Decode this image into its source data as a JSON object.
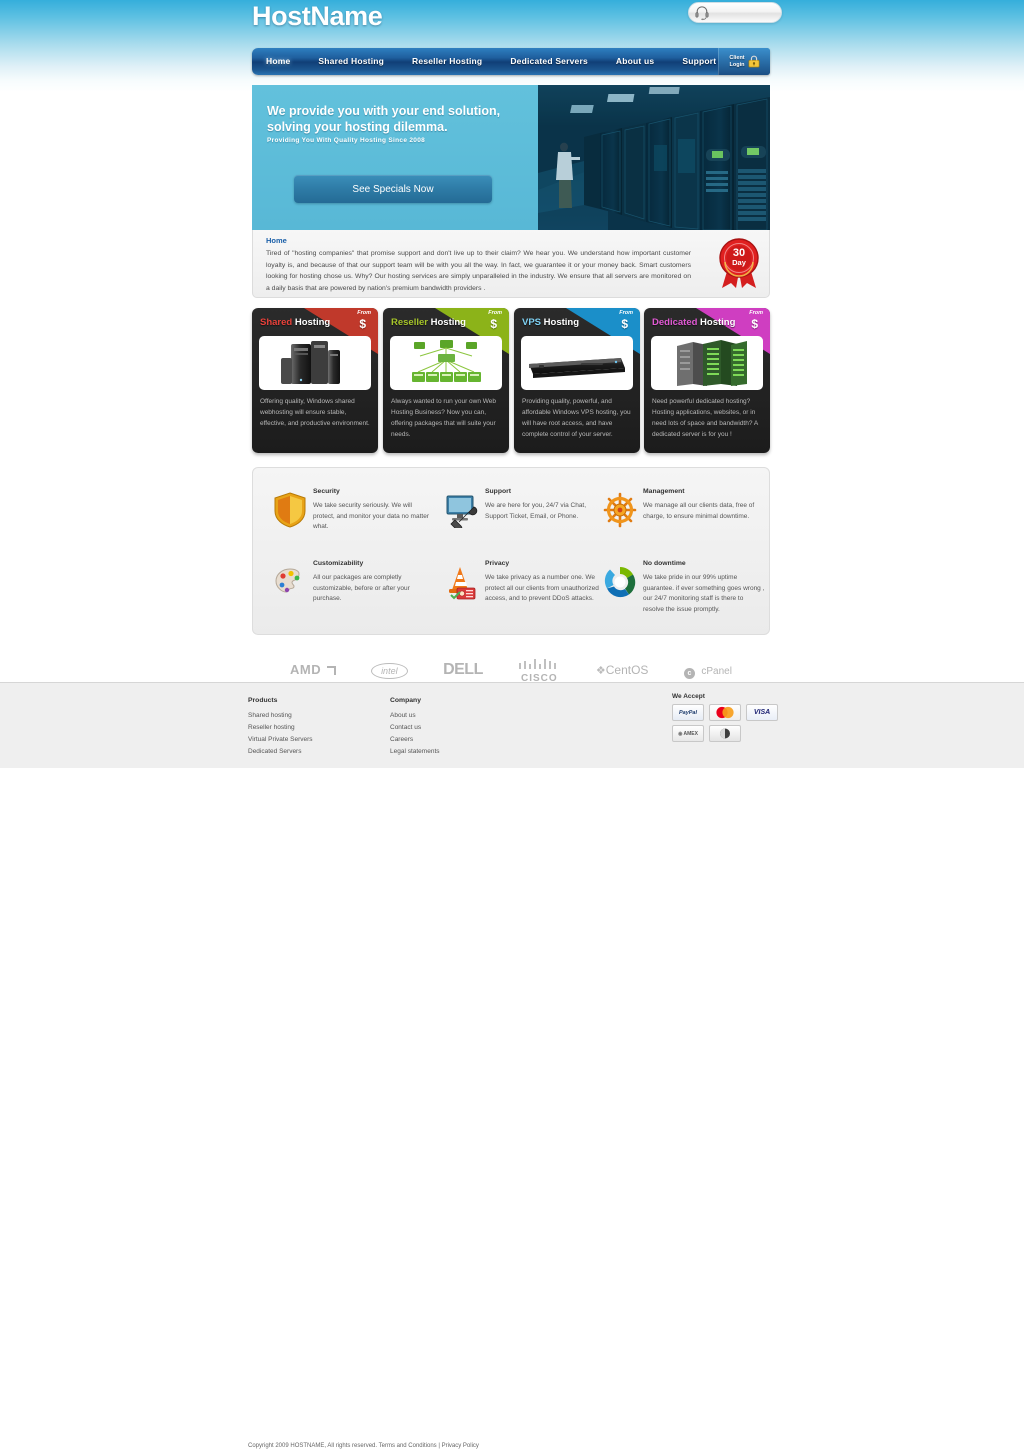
{
  "site": {
    "logo": "HostName",
    "support_pill_icon": "headset-icon"
  },
  "nav": {
    "items": [
      {
        "label": "Home",
        "active": true
      },
      {
        "label": "Shared Hosting",
        "active": false
      },
      {
        "label": "Reseller Hosting",
        "active": false
      },
      {
        "label": "Dedicated Servers",
        "active": false
      },
      {
        "label": "About us",
        "active": false
      },
      {
        "label": "Support",
        "active": false
      }
    ],
    "client_login": {
      "line1": "Client",
      "line2": "Login"
    }
  },
  "hero": {
    "title_line1": "We provide you with your end solution,",
    "title_line2": "solving your hosting dilemma.",
    "subtitle": "Providing You With Quality Hosting  Since 2008",
    "button": "See Specials Now"
  },
  "intro": {
    "title": "Home",
    "body": "Tired of \"hosting companies\" that promise support and don't live up to their claim? We hear you. We understand how important customer loyalty is, and because of that our support team will be with you all the way. In fact, we guarantee it or your money back. Smart customers looking for hosting chose us. Why? Our hosting services are simply unparalleled in the industry. We ensure that all servers are monitored on a daily basis that are powered by nation's premium bandwidth providers .",
    "seal_number": "30",
    "seal_unit": "Day"
  },
  "cards": [
    {
      "title_accent": "Shared",
      "title_rest": "Hosting",
      "accent_color": "#e8413a",
      "ribbon_color": "#c0392b",
      "ribbon_from": "From",
      "ribbon_price": "$",
      "image": "desktop-tower-servers-image",
      "text": "Offering quality, Windows shared webhosting will ensure stable, effective, and productive environment."
    },
    {
      "title_accent": "Reseller",
      "title_rest": "Hosting",
      "accent_color": "#a6c52a",
      "ribbon_color": "#8cb319",
      "ribbon_from": "From",
      "ribbon_price": "$",
      "image": "network-diagram-image",
      "text": "Always wanted to run your own Web Hosting Business? Now you can, offering packages that will suite your needs."
    },
    {
      "title_accent": "VPS",
      "title_rest": "Hosting",
      "accent_color": "#2f9fd6",
      "ribbon_color": "#1b8fc9",
      "ribbon_from": "From",
      "ribbon_price": "$",
      "image": "rack-server-image",
      "text": "Providing quality, powerful, and affordable Windows VPS hosting, you will have root access, and have complete control of your server."
    },
    {
      "title_accent": "Dedicated",
      "title_rest": "Hosting",
      "accent_color": "#d64bc8",
      "ribbon_color": "#cf3ec1",
      "ribbon_from": "From",
      "ribbon_price": "$",
      "image": "server-racks-image",
      "text": "Need powerful dedicated hosting? Hosting applications, websites, or in need lots of space and bandwidth? A dedicated server is for you !"
    }
  ],
  "features": [
    {
      "icon": "shield-icon",
      "title": "Security",
      "text": "We take security seriously. We will protect, and monitor your data no matter what."
    },
    {
      "icon": "monitor-wrench-icon",
      "title": "Support",
      "text": "We are here for you, 24/7 via Chat, Support Ticket, Email, or Phone."
    },
    {
      "icon": "ship-wheel-icon",
      "title": "Management",
      "text": "We manage all our clients data, free of charge, to ensure minimal downtime."
    },
    {
      "icon": "paint-palette-icon",
      "title": "Customizability",
      "text": "All our packages are completly customizable, before or after your purchase."
    },
    {
      "icon": "traffic-cone-id-icon",
      "title": "Privacy",
      "text": "We take privacy as a number one. We protect all our clients from unauthorized access, and to prevent DDoS attacks."
    },
    {
      "icon": "refresh-circle-icon",
      "title": "No downtime",
      "text": "We take pride in our 99% uptime guarantee. if ever something goes wrong , our 24/7 monitoring staff is there to resolve the issue promptly."
    }
  ],
  "partners": [
    {
      "name": "AMD"
    },
    {
      "name": "intel"
    },
    {
      "name": "DELL"
    },
    {
      "name": "CISCO"
    },
    {
      "name": "CentOS"
    },
    {
      "name": "cPanel"
    }
  ],
  "footer": {
    "products": {
      "heading": "Products",
      "links": [
        "Shared hosting",
        "Reseller hosting",
        "Virtual Private Servers",
        "Dedicated Servers"
      ]
    },
    "company": {
      "heading": "Company",
      "links": [
        "About us",
        "Contact us",
        "Careers",
        "Legal statements"
      ]
    },
    "accept": {
      "heading": "We Accept",
      "methods": [
        "PayPal",
        "MasterCard",
        "VISA",
        "AMEX",
        "Discover"
      ]
    },
    "copyright_text": "Copyright 2009 HOSTNAME, All rights reserved.",
    "terms_link": "Terms and Conditions",
    "separator": "|",
    "privacy_link": "Privacy Policy"
  },
  "colors": {
    "sky_top": "#35aedb",
    "nav_blue": "#1f5f9e",
    "hero_blue": "#5cbcd8",
    "card_dark": "#222222",
    "footer_bg": "#efefef"
  }
}
